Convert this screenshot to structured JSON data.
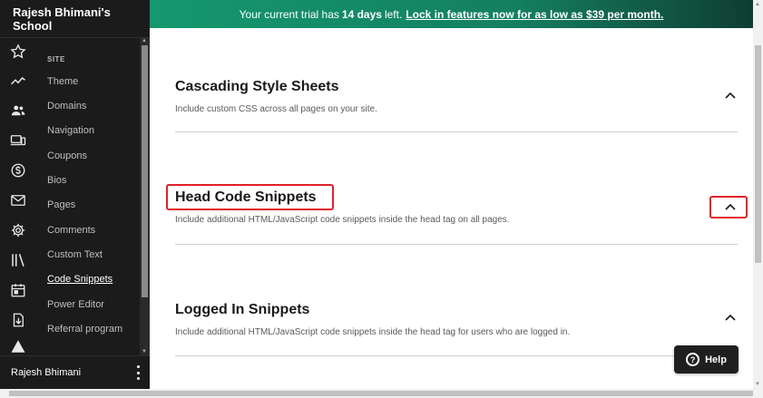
{
  "school_name": "Rajesh Bhimani's School",
  "banner": {
    "prefix": "Your current trial has",
    "days": "14 days",
    "middle": "left.",
    "link": "Lock in features now for as low as $39 per month."
  },
  "sidebar": {
    "section_label": "SITE",
    "icons": [
      "star-icon",
      "chart-line-icon",
      "users-icon",
      "devices-icon",
      "dollar-icon",
      "mail-icon",
      "gear-icon",
      "library-icon",
      "calendar-icon",
      "download-icon",
      "warning-icon"
    ],
    "items": [
      {
        "label": "Theme"
      },
      {
        "label": "Domains"
      },
      {
        "label": "Navigation"
      },
      {
        "label": "Coupons"
      },
      {
        "label": "Bios"
      },
      {
        "label": "Pages"
      },
      {
        "label": "Comments"
      },
      {
        "label": "Custom Text"
      },
      {
        "label": "Code Snippets",
        "active": true
      },
      {
        "label": "Power Editor"
      },
      {
        "label": "Referral program"
      }
    ],
    "user_name": "Rajesh Bhimani"
  },
  "sections": [
    {
      "title": "Cascading Style Sheets",
      "description": "Include custom CSS across all pages on your site."
    },
    {
      "title": "Head Code Snippets",
      "description": "Include additional HTML/JavaScript code snippets inside the head tag on all pages."
    },
    {
      "title": "Logged In Snippets",
      "description": "Include additional HTML/JavaScript code snippets inside the head tag for users who are logged in."
    }
  ],
  "help_label": "Help",
  "colors": {
    "banner": "#15986f",
    "sidebar": "#1b1b1b",
    "highlight": "#e0202a"
  }
}
